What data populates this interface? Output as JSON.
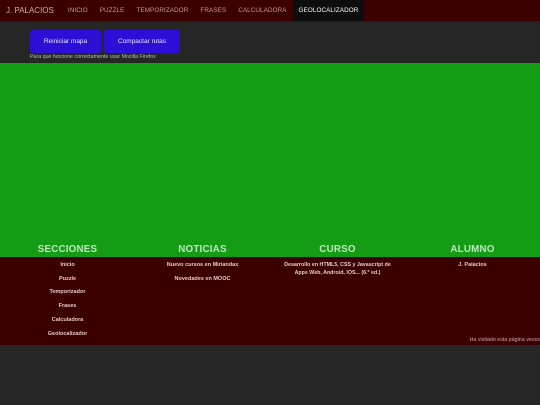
{
  "nav": {
    "brand": "J. PALACIOS",
    "items": [
      {
        "label": "INICIO",
        "active": false
      },
      {
        "label": "PUZZLE",
        "active": false
      },
      {
        "label": "TEMPORIZADOR",
        "active": false
      },
      {
        "label": "FRASES",
        "active": false
      },
      {
        "label": "CALCULADORA",
        "active": false
      },
      {
        "label": "GEOLOCALIZADOR",
        "active": true
      }
    ]
  },
  "toolbar": {
    "reset_label": "Reiniciar mapa",
    "compact_label": "Compactar rutas",
    "hint": "Para que funcione correctamente usar Mozilla Firefox"
  },
  "colors": {
    "nav_bg": "#3b0000",
    "button_bg": "#2a10d6",
    "map_bg": "#149c14",
    "page_bg": "#262626"
  },
  "footer": {
    "headings": [
      "SECCIONES",
      "NOTICIAS",
      "CURSO",
      "ALUMNO"
    ],
    "sections": [
      "Inicio",
      "Puzzle",
      "Temporizador",
      "Frases",
      "Calculadora",
      "Geolocalizador"
    ],
    "news": [
      "Nuevo cursos en Miriandax",
      "Novedades en MOOC"
    ],
    "course": "Desarrollo en HTML5, CSS y Javascript de Apps Web, Android, IOS... (6.ª ed.)",
    "student": "J. Palacios",
    "visits": "Ha visitado esta página veces"
  }
}
